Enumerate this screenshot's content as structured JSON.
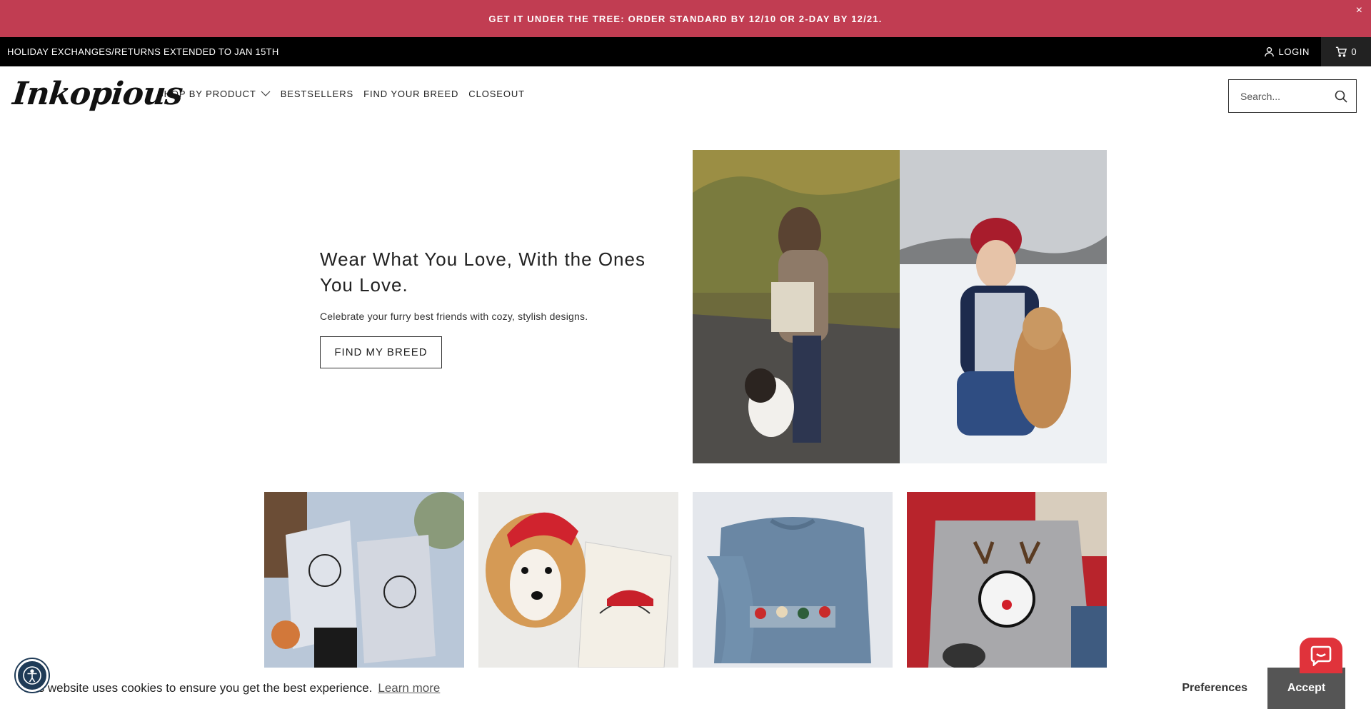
{
  "promo": {
    "text": "GET IT UNDER THE TREE: ORDER STANDARD BY 12/10 OR 2-DAY BY 12/21.",
    "close": "×",
    "bg_color": "#c13d52"
  },
  "topbar": {
    "notice": "HOLIDAY EXCHANGES/RETURNS EXTENDED TO JAN 15TH",
    "login": "LOGIN",
    "cart_count": "0"
  },
  "header": {
    "logo": "Inkopious",
    "nav": [
      "SHOP BY PRODUCT",
      "BESTSELLERS",
      "FIND YOUR BREED",
      "CLOSEOUT"
    ],
    "search_placeholder": "Search..."
  },
  "hero": {
    "title": "Wear What You Love, With the Ones You Love.",
    "subtitle": "Celebrate your furry best friends with cozy, stylish designs.",
    "button": "FIND MY BREED"
  },
  "images": {
    "hero_left": "woman-with-tote-and-dog-photo",
    "hero_right": "woman-in-snow-with-lab-photo",
    "tiles": [
      "thankful-tees-photo",
      "corgi-santa-tote-photo",
      "blue-sweatshirt-photo",
      "reindeer-dog-tee-photo"
    ]
  },
  "cookie": {
    "text": "This website uses cookies to ensure you get the best experience.",
    "learn_more": "Learn more",
    "preferences": "Preferences",
    "accept": "Accept"
  },
  "colors": {
    "accent": "#c13d52",
    "chat": "#e0333b",
    "accessibility": "#1f3b57"
  }
}
